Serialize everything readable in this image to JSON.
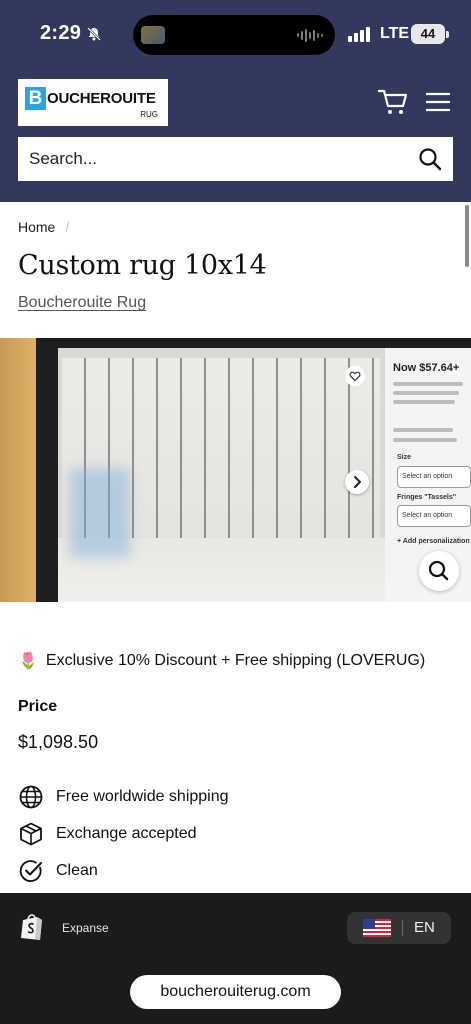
{
  "status_bar": {
    "time": "2:29",
    "network": "LTE",
    "battery": "44"
  },
  "header": {
    "logo": {
      "letter": "B",
      "name": "OUCHEROUITE",
      "sub": "RUG"
    },
    "search_placeholder": "Search..."
  },
  "breadcrumb": {
    "home": "Home",
    "separator": "/"
  },
  "product": {
    "title": "Custom rug 10x14",
    "vendor": "Boucherouite Rug",
    "promo_emoji": "🌷",
    "promo_text": "Exclusive 10% Discount + Free shipping (LOVERUG)",
    "price_label": "Price",
    "price": "$1,098.50",
    "features": [
      "Free worldwide shipping",
      "Exchange accepted",
      "Clean"
    ]
  },
  "photo_overlay": {
    "price": "Now $57.64+",
    "size_label": "Size",
    "size_option": "Select an option",
    "fringes_label": "Fringes \"Tassels\"",
    "fringes_option": "Select an option",
    "add_label": "+ Add personalization"
  },
  "footer": {
    "platform": "Expanse",
    "language": "EN",
    "url": "boucherouiterug.com"
  },
  "colors": {
    "header_bg": "#33395e",
    "footer_bg": "#1b1b1c",
    "logo_blue": "#28a4e0"
  }
}
